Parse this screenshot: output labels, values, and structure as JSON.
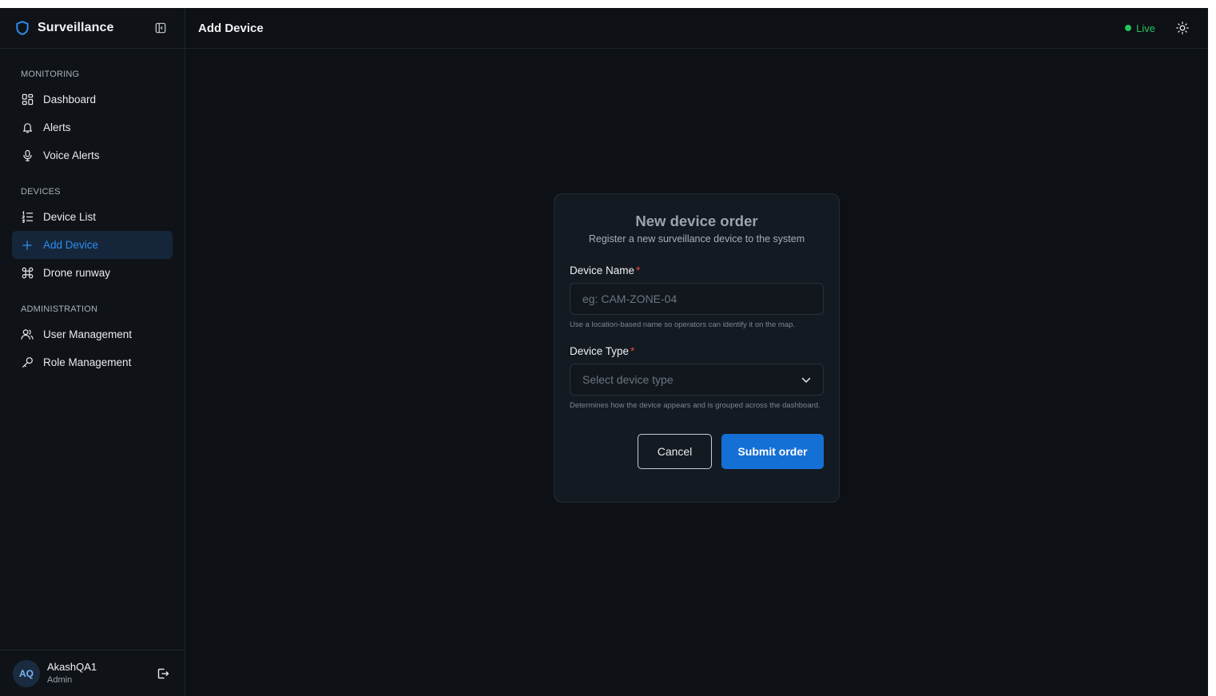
{
  "brand": {
    "name": "Surveillance",
    "accent": "#2b8df0"
  },
  "sidebar": {
    "sections": [
      {
        "label": "MONITORING",
        "items": [
          {
            "label": "Dashboard",
            "icon": "dashboard-icon"
          },
          {
            "label": "Alerts",
            "icon": "bell-icon"
          },
          {
            "label": "Voice Alerts",
            "icon": "microphone-icon"
          }
        ]
      },
      {
        "label": "DEVICES",
        "items": [
          {
            "label": "Device List",
            "icon": "list-icon"
          },
          {
            "label": "Add Device",
            "icon": "plus-icon",
            "active": true
          },
          {
            "label": "Drone runway",
            "icon": "drone-icon"
          }
        ]
      },
      {
        "label": "ADMINISTRATION",
        "items": [
          {
            "label": "User Management",
            "icon": "users-icon"
          },
          {
            "label": "Role Management",
            "icon": "key-icon"
          }
        ]
      }
    ]
  },
  "user": {
    "initials": "AQ",
    "name": "AkashQA1",
    "role": "Admin"
  },
  "header": {
    "title": "Add Device",
    "status": "Live",
    "status_color": "#22c55e"
  },
  "form": {
    "title": "New device order",
    "subtitle": "Register a new surveillance device to the system",
    "device_name": {
      "label": "Device Name",
      "required": "*",
      "placeholder": "eg: CAM-ZONE-04",
      "hint": "Use a location-based name so operators can identify it on the map."
    },
    "device_type": {
      "label": "Device Type",
      "required": "*",
      "placeholder": "Select device type",
      "hint": "Determines how the device appears and is grouped across the dashboard."
    },
    "cancel_label": "Cancel",
    "submit_label": "Submit order"
  }
}
